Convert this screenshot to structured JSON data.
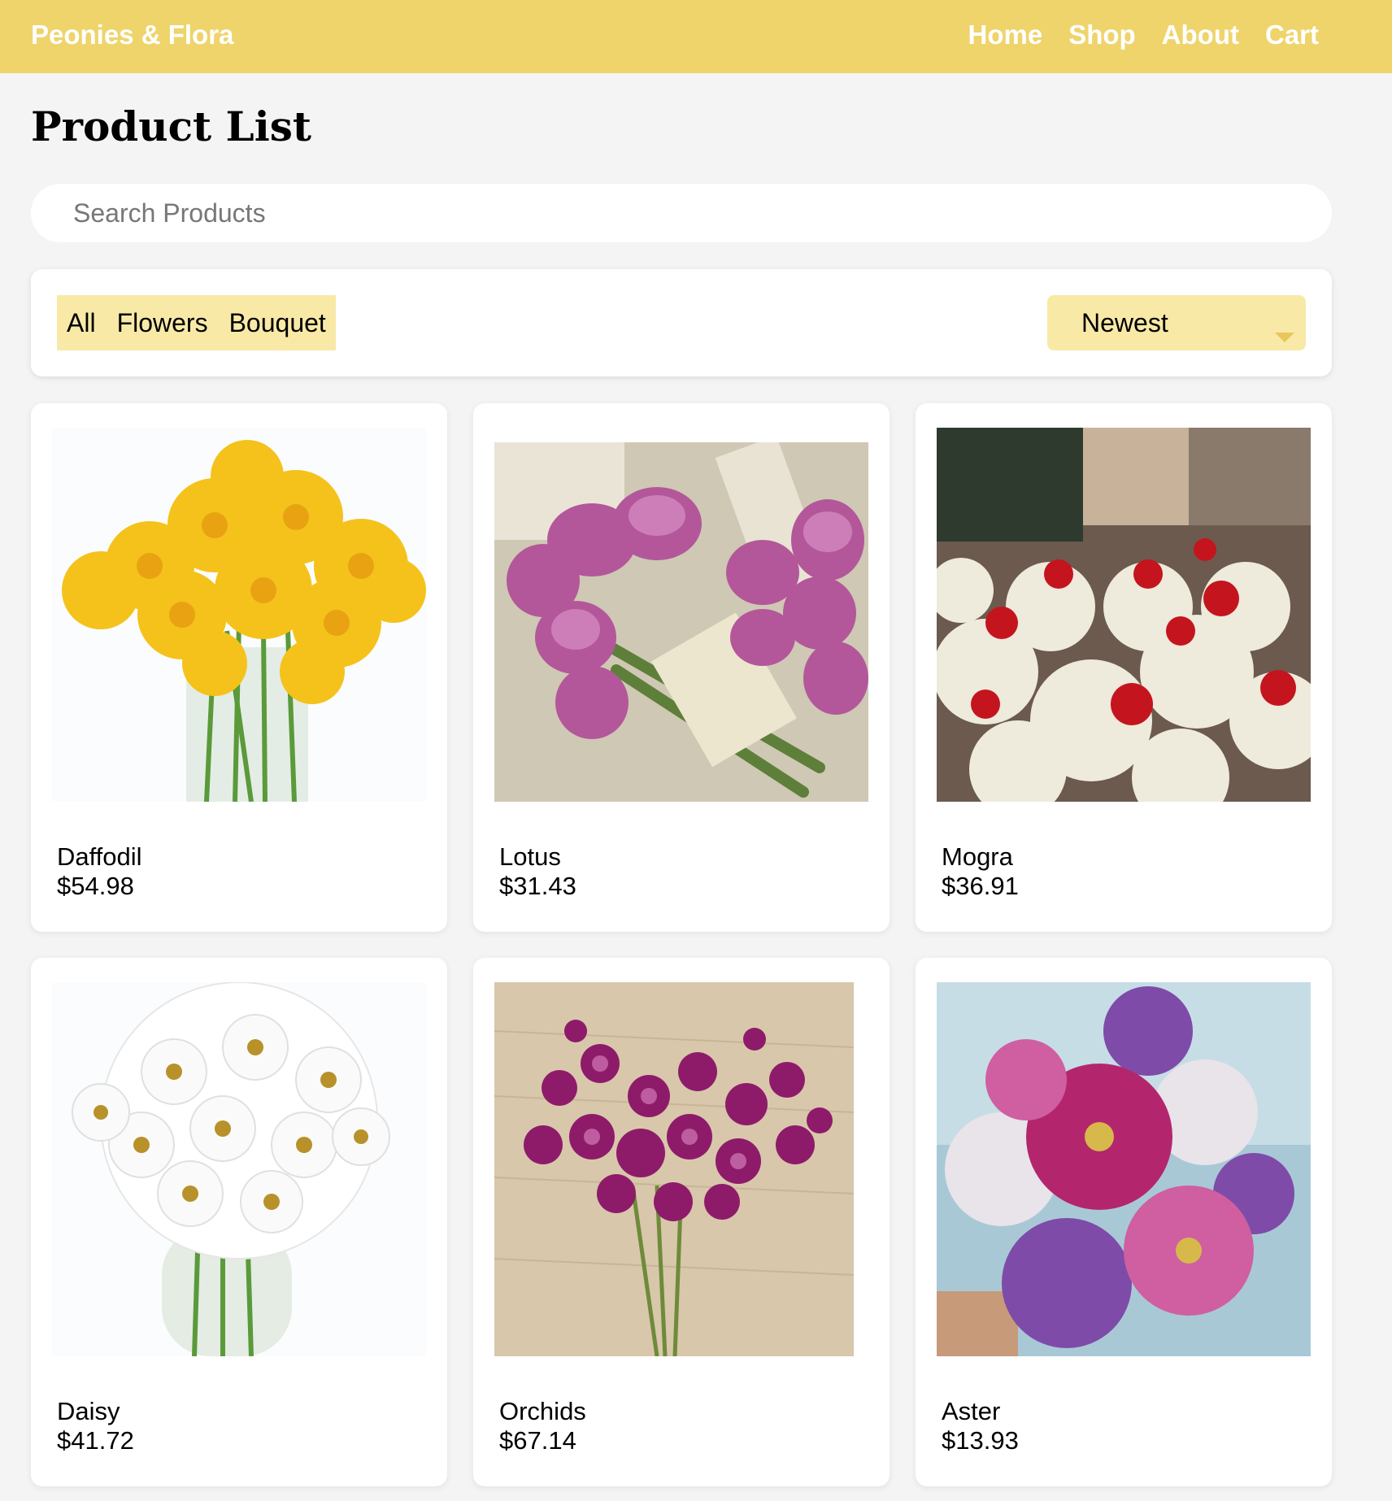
{
  "header": {
    "brand": "Peonies & Flora",
    "nav": [
      "Home",
      "Shop",
      "About",
      "Cart"
    ]
  },
  "page": {
    "title": "Product List"
  },
  "search": {
    "placeholder": "Search Products",
    "value": ""
  },
  "filters": {
    "categories": [
      "All",
      "Flowers",
      "Bouquet"
    ],
    "sort_selected": "Newest"
  },
  "products": [
    {
      "name": "Daffodil",
      "price": "$54.98",
      "image_icon": "daffodil-image"
    },
    {
      "name": "Lotus",
      "price": "$31.43",
      "image_icon": "lotus-image"
    },
    {
      "name": "Mogra",
      "price": "$36.91",
      "image_icon": "mogra-image"
    },
    {
      "name": "Daisy",
      "price": "$41.72",
      "image_icon": "daisy-image"
    },
    {
      "name": "Orchids",
      "price": "$67.14",
      "image_icon": "orchids-image"
    },
    {
      "name": "Aster",
      "price": "$13.93",
      "image_icon": "aster-image"
    }
  ],
  "colors": {
    "header_bg": "#eed46b",
    "filter_bg": "#f8e9a7",
    "page_bg": "#f4f4f4"
  }
}
